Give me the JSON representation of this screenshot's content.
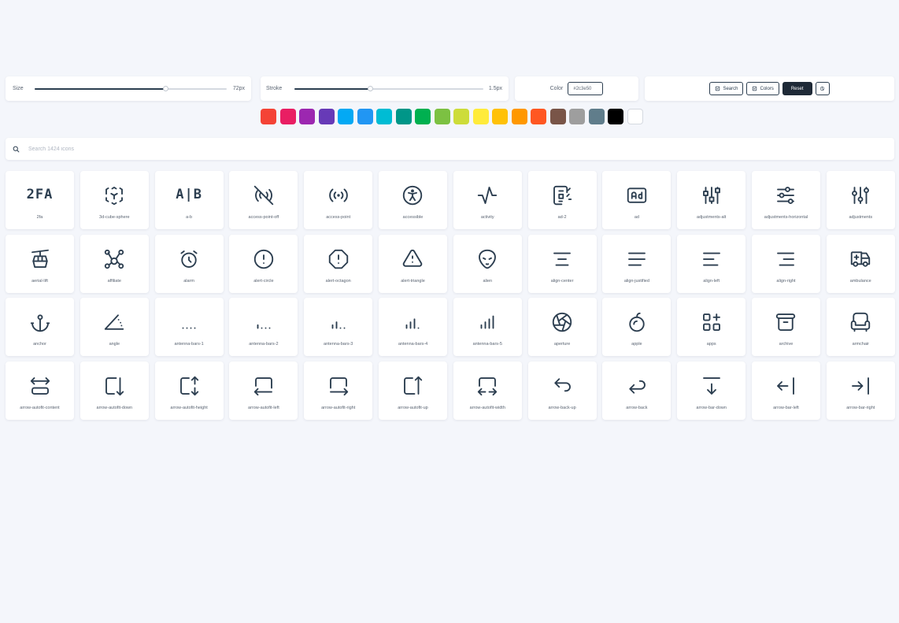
{
  "controls": {
    "size": {
      "label": "Size",
      "value_text": "72px",
      "fraction": 0.68
    },
    "stroke": {
      "label": "Stroke",
      "value_text": "1.5px",
      "fraction": 0.4
    },
    "color": {
      "label": "Color",
      "value": "#2c3e50"
    },
    "buttons": {
      "search": "Search",
      "colors": "Colors",
      "reset": "Reset"
    }
  },
  "swatches": [
    "#f44336",
    "#e91e63",
    "#9c27b0",
    "#673ab7",
    "#03a9f4",
    "#2196f3",
    "#00bcd4",
    "#009688",
    "#00b050",
    "#7cc142",
    "#cddc39",
    "#ffeb3b",
    "#ffc107",
    "#ff9800",
    "#ff5722",
    "#795548",
    "#9e9e9e",
    "#607d8b",
    "#000000",
    "#ffffff"
  ],
  "search": {
    "placeholder": "Search 1424 icons",
    "icon": "search-icon"
  },
  "icons": [
    {
      "name": "2fa",
      "glyph": "2fa",
      "text": "2FA"
    },
    {
      "name": "3d-cube-sphere",
      "glyph": "cube"
    },
    {
      "name": "a-b",
      "glyph": "ab",
      "text": "A|B"
    },
    {
      "name": "access-point-off",
      "glyph": "apoff"
    },
    {
      "name": "access-point",
      "glyph": "ap"
    },
    {
      "name": "accessible",
      "glyph": "accessible"
    },
    {
      "name": "activity",
      "glyph": "activity"
    },
    {
      "name": "ad-2",
      "glyph": "ad2"
    },
    {
      "name": "ad",
      "glyph": "ad"
    },
    {
      "name": "adjustments-alt",
      "glyph": "adjalt"
    },
    {
      "name": "adjustments-horizontal",
      "glyph": "adjh"
    },
    {
      "name": "adjustments",
      "glyph": "adj"
    },
    {
      "name": "aerial-lift",
      "glyph": "aerial"
    },
    {
      "name": "affiliate",
      "glyph": "affiliate"
    },
    {
      "name": "alarm",
      "glyph": "alarm"
    },
    {
      "name": "alert-circle",
      "glyph": "alertcircle"
    },
    {
      "name": "alert-octagon",
      "glyph": "alertoct"
    },
    {
      "name": "alert-triangle",
      "glyph": "alerttri"
    },
    {
      "name": "alien",
      "glyph": "alien"
    },
    {
      "name": "align-center",
      "glyph": "alc"
    },
    {
      "name": "align-justified",
      "glyph": "alj"
    },
    {
      "name": "align-left",
      "glyph": "all"
    },
    {
      "name": "align-right",
      "glyph": "alr"
    },
    {
      "name": "ambulance",
      "glyph": "ambulance"
    },
    {
      "name": "anchor",
      "glyph": "anchor"
    },
    {
      "name": "angle",
      "glyph": "angle"
    },
    {
      "name": "antenna-bars-1",
      "glyph": "ab1"
    },
    {
      "name": "antenna-bars-2",
      "glyph": "ab2"
    },
    {
      "name": "antenna-bars-3",
      "glyph": "ab3"
    },
    {
      "name": "antenna-bars-4",
      "glyph": "ab4"
    },
    {
      "name": "antenna-bars-5",
      "glyph": "ab5"
    },
    {
      "name": "aperture",
      "glyph": "aperture"
    },
    {
      "name": "apple",
      "glyph": "apple"
    },
    {
      "name": "apps",
      "glyph": "apps"
    },
    {
      "name": "archive",
      "glyph": "archive"
    },
    {
      "name": "armchair",
      "glyph": "armchair"
    },
    {
      "name": "arrow-autofit-content",
      "glyph": "afc"
    },
    {
      "name": "arrow-autofit-down",
      "glyph": "afd"
    },
    {
      "name": "arrow-autofit-height",
      "glyph": "afh"
    },
    {
      "name": "arrow-autofit-left",
      "glyph": "afl"
    },
    {
      "name": "arrow-autofit-right",
      "glyph": "afr"
    },
    {
      "name": "arrow-autofit-up",
      "glyph": "afu"
    },
    {
      "name": "arrow-autofit-width",
      "glyph": "afw"
    },
    {
      "name": "arrow-back-up",
      "glyph": "backup"
    },
    {
      "name": "arrow-back",
      "glyph": "back"
    },
    {
      "name": "arrow-bar-down",
      "glyph": "bardown"
    },
    {
      "name": "arrow-bar-left",
      "glyph": "barleft"
    },
    {
      "name": "arrow-bar-right",
      "glyph": "barright"
    }
  ]
}
